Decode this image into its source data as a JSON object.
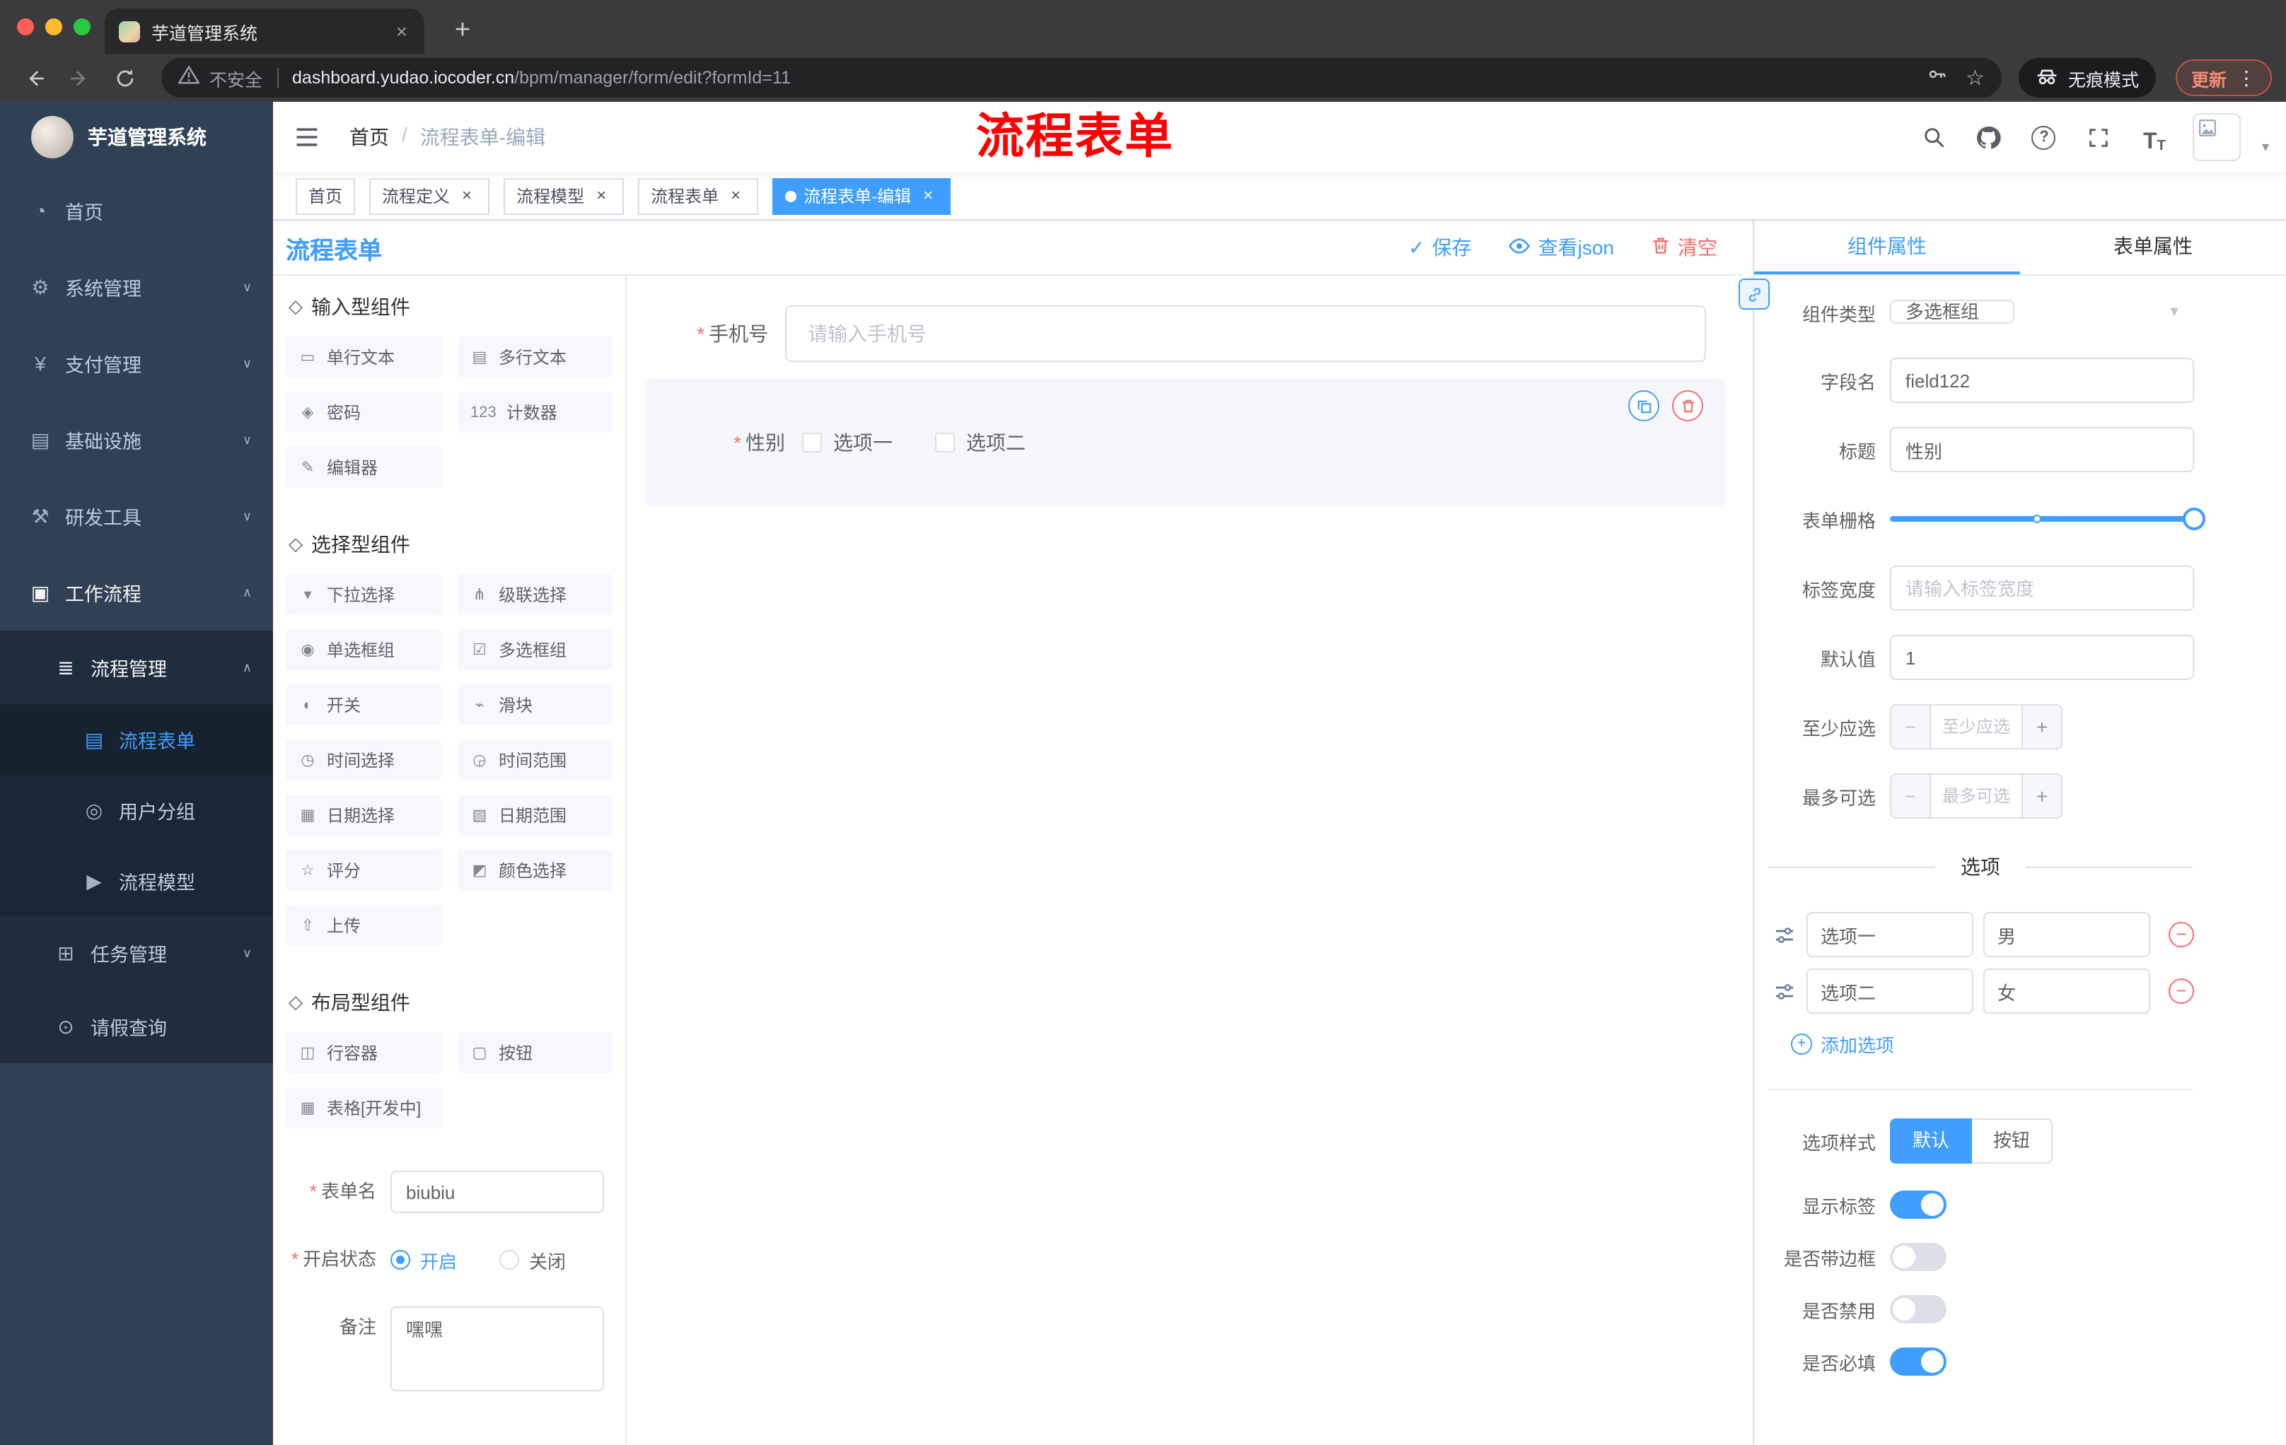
{
  "browser": {
    "tab_title": "芋道管理系统",
    "security_label": "不安全",
    "url_host": "dashboard.yudao.iocoder.cn",
    "url_path": "/bpm/manager/form/edit?formId=11",
    "incognito_label": "无痕模式",
    "update_label": "更新"
  },
  "sidebar": {
    "brand": "芋道管理系统",
    "items": [
      {
        "name": "home",
        "label": "首页",
        "icon": "dashboard-icon",
        "level": 0,
        "chevron": null,
        "open": false,
        "current": false
      },
      {
        "name": "system-management",
        "label": "系统管理",
        "icon": "gear-icon",
        "level": 0,
        "chevron": "down",
        "open": false,
        "current": false
      },
      {
        "name": "payment-management",
        "label": "支付管理",
        "icon": "yen-icon",
        "level": 0,
        "chevron": "down",
        "open": false,
        "current": false
      },
      {
        "name": "infrastructure",
        "label": "基础设施",
        "icon": "monitor-icon",
        "level": 0,
        "chevron": "down",
        "open": false,
        "current": false
      },
      {
        "name": "dev-tools",
        "label": "研发工具",
        "icon": "tools-icon",
        "level": 0,
        "chevron": "down",
        "open": false,
        "current": false
      },
      {
        "name": "workflow",
        "label": "工作流程",
        "icon": "briefcase-icon",
        "level": 0,
        "chevron": "up",
        "open": true,
        "current": false
      },
      {
        "name": "process-management",
        "label": "流程管理",
        "icon": "list-icon",
        "level": 1,
        "chevron": "up",
        "open": true,
        "current": false
      },
      {
        "name": "process-form",
        "label": "流程表单",
        "icon": "document-icon",
        "level": 2,
        "chevron": null,
        "open": false,
        "current": true
      },
      {
        "name": "user-group",
        "label": "用户分组",
        "icon": "users-icon",
        "level": 2,
        "chevron": null,
        "open": false,
        "current": false
      },
      {
        "name": "process-model",
        "label": "流程模型",
        "icon": "send-icon",
        "level": 2,
        "chevron": null,
        "open": false,
        "current": false
      },
      {
        "name": "task-management",
        "label": "任务管理",
        "icon": "flow-icon",
        "level": 1,
        "chevron": "down",
        "open": false,
        "current": false
      },
      {
        "name": "leave-query",
        "label": "请假查询",
        "icon": "person-icon",
        "level": 1,
        "chevron": null,
        "open": false,
        "current": false
      }
    ]
  },
  "header": {
    "breadcrumb_home": "首页",
    "breadcrumb_sep": "/",
    "breadcrumb_current": "流程表单-编辑",
    "annotation": "流程表单"
  },
  "tags": [
    {
      "name": "home",
      "label": "首页",
      "closable": false,
      "active": false
    },
    {
      "name": "process-definition",
      "label": "流程定义",
      "closable": true,
      "active": false
    },
    {
      "name": "process-model",
      "label": "流程模型",
      "closable": true,
      "active": false
    },
    {
      "name": "process-form",
      "label": "流程表单",
      "closable": true,
      "active": false
    },
    {
      "name": "process-form-edit",
      "label": "流程表单-编辑",
      "closable": true,
      "active": true
    }
  ],
  "designer": {
    "title": "流程表单",
    "actions": {
      "save": "保存",
      "view_json": "查看json",
      "clear": "清空"
    },
    "groups": [
      {
        "title": "输入型组件",
        "items": [
          {
            "name": "single-line-text",
            "label": "单行文本",
            "icon": "text-field-icon"
          },
          {
            "name": "multi-line-text",
            "label": "多行文本",
            "icon": "textarea-icon"
          },
          {
            "name": "password",
            "label": "密码",
            "icon": "lock-icon"
          },
          {
            "name": "counter",
            "label": "计数器",
            "icon": "counter-icon"
          },
          {
            "name": "editor",
            "label": "编辑器",
            "icon": "editor-icon"
          }
        ]
      },
      {
        "title": "选择型组件",
        "items": [
          {
            "name": "select",
            "label": "下拉选择",
            "icon": "select-icon"
          },
          {
            "name": "cascader",
            "label": "级联选择",
            "icon": "cascader-icon"
          },
          {
            "name": "radio-group",
            "label": "单选框组",
            "icon": "radio-icon"
          },
          {
            "name": "checkbox-group",
            "label": "多选框组",
            "icon": "checkbox-icon"
          },
          {
            "name": "switch",
            "label": "开关",
            "icon": "switch-icon"
          },
          {
            "name": "slider",
            "label": "滑块",
            "icon": "slider-icon"
          },
          {
            "name": "time-picker",
            "label": "时间选择",
            "icon": "time-icon"
          },
          {
            "name": "time-range",
            "label": "时间范围",
            "icon": "time-range-icon"
          },
          {
            "name": "date-picker",
            "label": "日期选择",
            "icon": "date-icon"
          },
          {
            "name": "date-range",
            "label": "日期范围",
            "icon": "date-range-icon"
          },
          {
            "name": "rate",
            "label": "评分",
            "icon": "star-icon"
          },
          {
            "name": "color-picker",
            "label": "颜色选择",
            "icon": "color-icon"
          },
          {
            "name": "upload",
            "label": "上传",
            "icon": "upload-icon"
          }
        ]
      },
      {
        "title": "布局型组件",
        "items": [
          {
            "name": "row-container",
            "label": "行容器",
            "icon": "row-icon"
          },
          {
            "name": "button",
            "label": "按钮",
            "icon": "button-icon"
          },
          {
            "name": "table",
            "label": "表格[开发中]",
            "icon": "table-icon"
          }
        ]
      }
    ],
    "meta": {
      "name_label": "表单名",
      "name_value": "biubiu",
      "status_label": "开启状态",
      "status_on": "开启",
      "status_off": "关闭",
      "remark_label": "备注",
      "remark_value": "嘿嘿"
    }
  },
  "canvas": {
    "phone_label": "手机号",
    "phone_placeholder": "请输入手机号",
    "gender_label": "性别",
    "gender_options": [
      "选项一",
      "选项二"
    ]
  },
  "props": {
    "tabs": [
      "组件属性",
      "表单属性"
    ],
    "type_label": "组件类型",
    "type_value": "多选框组",
    "field_label": "字段名",
    "field_value": "field122",
    "title_label": "标题",
    "title_value": "性别",
    "grid_label": "表单栅格",
    "label_width_label": "标签宽度",
    "label_width_placeholder": "请输入标签宽度",
    "default_label": "默认值",
    "default_value": "1",
    "min_label": "至少应选",
    "min_placeholder": "至少应选",
    "max_label": "最多可选",
    "max_placeholder": "最多可选",
    "options_divider": "选项",
    "options": [
      {
        "label": "选项一",
        "value": "男"
      },
      {
        "label": "选项二",
        "value": "女"
      }
    ],
    "add_option": "添加选项",
    "style_label": "选项样式",
    "style_default": "默认",
    "style_button": "按钮",
    "switches": [
      {
        "name": "show-label",
        "label": "显示标签",
        "on": true
      },
      {
        "name": "border",
        "label": "是否带边框",
        "on": false
      },
      {
        "name": "disabled",
        "label": "是否禁用",
        "on": false
      },
      {
        "name": "required",
        "label": "是否必填",
        "on": true
      }
    ]
  },
  "colors": {
    "accent": "#409EFF",
    "danger": "#F56C6C",
    "sidebar_bg": "#304156",
    "annotation": "#FF0000"
  }
}
